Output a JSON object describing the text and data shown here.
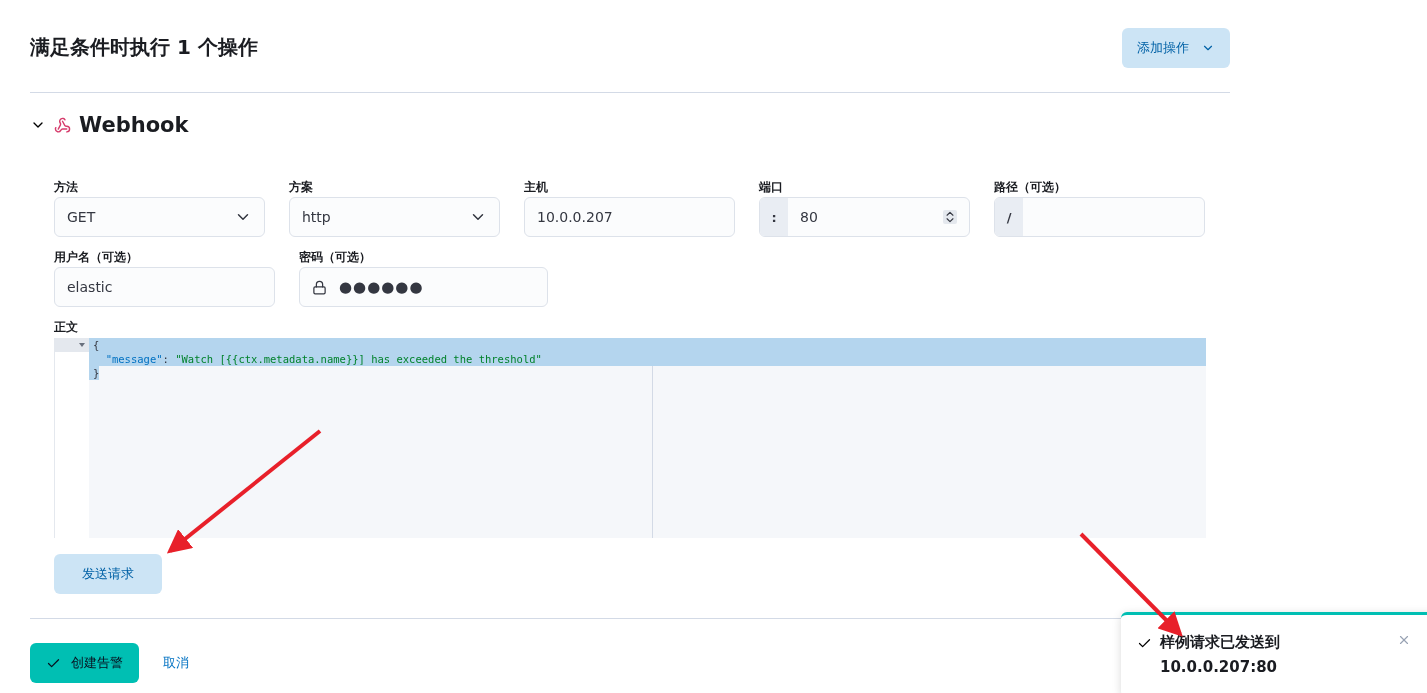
{
  "header": {
    "title": "满足条件时执行 1 个操作",
    "add_button": "添加操作"
  },
  "action": {
    "title": "Webhook",
    "expanded": true
  },
  "fields_row1": [
    {
      "kind": "select",
      "label": "方法",
      "value": "GET"
    },
    {
      "kind": "select",
      "label": "方案",
      "value": "http"
    },
    {
      "kind": "text",
      "label": "主机",
      "value": "10.0.0.207"
    },
    {
      "kind": "number",
      "label": "端口",
      "prefix": ":",
      "value": "80"
    },
    {
      "kind": "text",
      "label": "路径（可选）",
      "prefix": "/"
    }
  ],
  "fields_row2": [
    {
      "kind": "text",
      "label": "用户名（可选）",
      "value": "elastic"
    },
    {
      "kind": "password",
      "label": "密码（可选）",
      "value": "●●●●●●"
    }
  ],
  "body": {
    "label": "正文",
    "lines": [
      {
        "selected": true,
        "selected_to_end": true,
        "tokens": [
          {
            "kind": "punct",
            "text": "{"
          }
        ]
      },
      {
        "selected": true,
        "selected_to_end": true,
        "tokens": [
          {
            "kind": "key",
            "text": "  \"message\""
          },
          {
            "kind": "punct",
            "text": ": "
          },
          {
            "kind": "string",
            "text": "\"Watch [{{ctx.metadata.name}}] has exceeded the threshold\""
          }
        ]
      },
      {
        "selected": true,
        "selected_to_end": false,
        "tokens": [
          {
            "kind": "punct",
            "text": "}"
          }
        ]
      }
    ]
  },
  "send_button": "发送请求",
  "footer": {
    "create_button": "创建告警",
    "cancel_link": "取消"
  },
  "toast": {
    "title": "样例请求已发送到",
    "detail": "10.0.0.207:80"
  }
}
